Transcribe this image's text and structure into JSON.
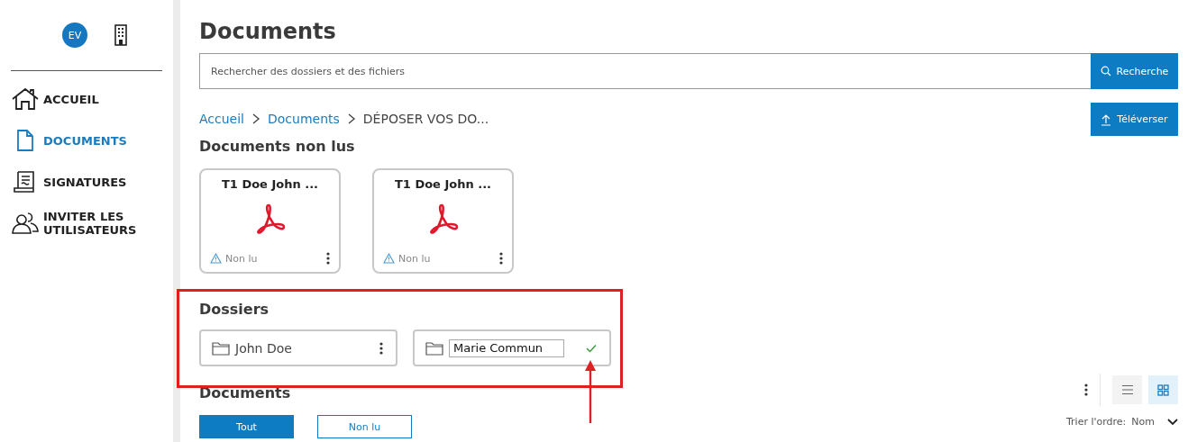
{
  "sidebar": {
    "avatar": "EV",
    "nav": [
      {
        "label": "ACCUEIL",
        "kind": "home",
        "selected": false
      },
      {
        "label": "DOCUMENTS",
        "kind": "document",
        "selected": true
      },
      {
        "label": "SIGNATURES",
        "kind": "signature",
        "selected": false
      },
      {
        "label": "INVITER LES UTILISATEURS",
        "kind": "users",
        "selected": false
      }
    ]
  },
  "main": {
    "title": "Documents",
    "search": {
      "placeholder": "Rechercher des dossiers et des fichiers",
      "button": "Recherche"
    },
    "breadcrumb": [
      {
        "label": "Accueil",
        "link": true
      },
      {
        "label": "Documents",
        "link": true
      },
      {
        "label": "DÉPOSER VOS DO...",
        "link": false
      }
    ],
    "upload_button": "Téléverser",
    "unread": {
      "title": "Documents non lus",
      "cards": [
        {
          "title": "T1 Doe John ...",
          "status": "Non lu"
        },
        {
          "title": "T1 Doe John ...",
          "status": "Non lu"
        }
      ]
    },
    "folders": {
      "title": "Dossiers",
      "items": [
        {
          "name": "John Doe",
          "editing": false
        },
        {
          "name": "Marie Commun",
          "editing": true
        }
      ]
    },
    "documents": {
      "title": "Documents",
      "filters": [
        {
          "label": "Tout",
          "selected": true
        },
        {
          "label": "Non lu",
          "selected": false
        }
      ],
      "views": [
        {
          "kind": "list",
          "selected": false
        },
        {
          "kind": "grid",
          "selected": true
        }
      ],
      "sort_label": "Trier l'ordre:",
      "sort_value": "Nom"
    }
  }
}
